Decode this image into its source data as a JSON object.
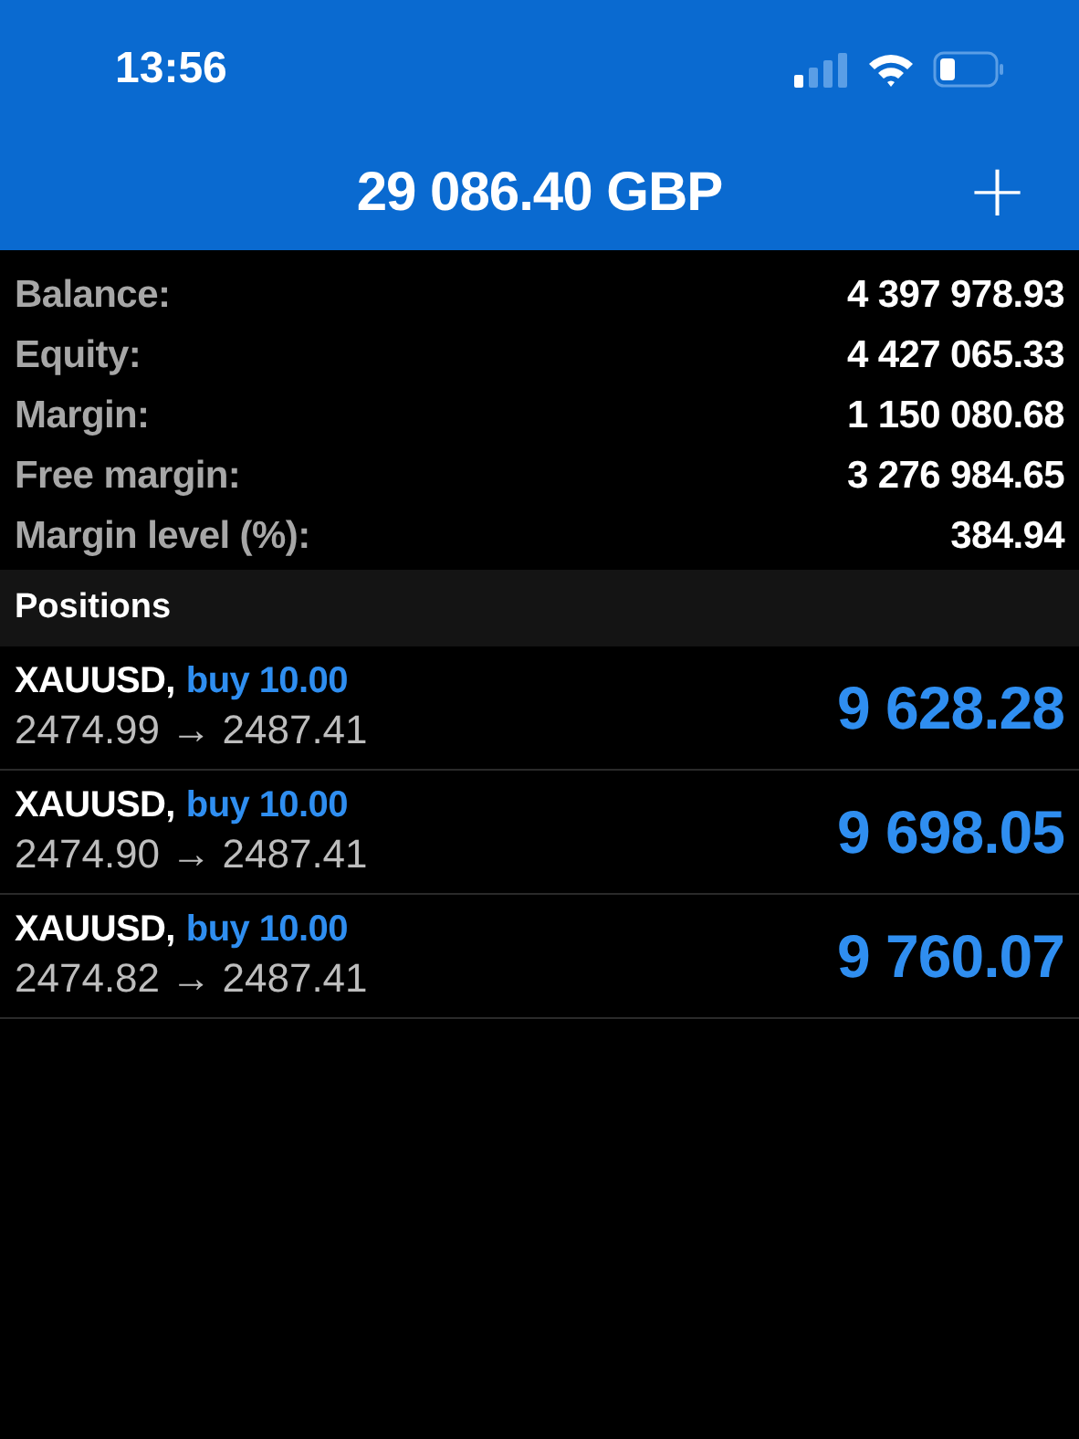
{
  "status_bar": {
    "time": "13:56"
  },
  "header": {
    "title": "29 086.40 GBP",
    "action": "+"
  },
  "summary": [
    {
      "label": "Balance:",
      "value": "4 397 978.93"
    },
    {
      "label": "Equity:",
      "value": "4 427 065.33"
    },
    {
      "label": "Margin:",
      "value": "1 150 080.68"
    },
    {
      "label": "Free margin:",
      "value": "3 276 984.65"
    },
    {
      "label": "Margin level (%):",
      "value": "384.94"
    }
  ],
  "positions": {
    "title": "Positions",
    "rows": [
      {
        "symbol": "XAUUSD,",
        "side": "buy",
        "volume": "10.00",
        "prices": "2474.99 → 2487.41",
        "profit": "9 628.28"
      },
      {
        "symbol": "XAUUSD,",
        "side": "buy",
        "volume": "10.00",
        "prices": "2474.90 → 2487.41",
        "profit": "9 698.05"
      },
      {
        "symbol": "XAUUSD,",
        "side": "buy",
        "volume": "10.00",
        "prices": "2474.82 → 2487.41",
        "profit": "9 760.07"
      }
    ]
  }
}
